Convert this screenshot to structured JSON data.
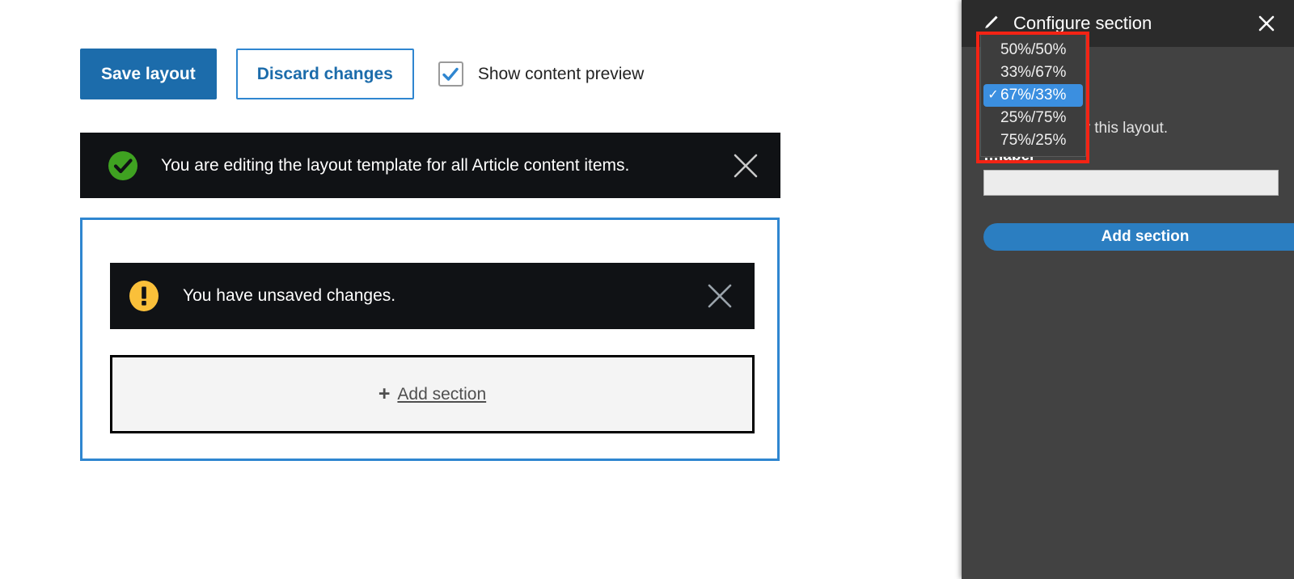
{
  "toolbar": {
    "save_label": "Save layout",
    "discard_label": "Discard changes",
    "preview_checkbox_label": "Show content preview",
    "preview_checked": true,
    "save_bg": "#1c6cab",
    "discard_border": "#2f86d0"
  },
  "status_message": {
    "icon": "success-check-circle-icon",
    "text": "You are editing the layout template for all Article content items.",
    "close_icon": "close-icon",
    "bg": "#101215",
    "icon_color": "#3fa221"
  },
  "layout_region": {
    "border_color": "#2f86d0",
    "unsaved_message": {
      "icon": "warning-exclamation-circle-icon",
      "text": "You have unsaved changes.",
      "close_icon": "close-icon",
      "bg": "#101215",
      "icon_color": "#fac03a"
    },
    "add_section": {
      "plus_glyph": "+",
      "label": "Add section"
    }
  },
  "config_panel": {
    "header": {
      "icon": "pencil-icon",
      "title": "Configure section",
      "close_icon": "close-icon",
      "bg": "#2b2b2b"
    },
    "bg": "#424242",
    "help_text": "…mn widths for this layout.",
    "field_label": "…label",
    "input_value": "",
    "input_placeholder": "",
    "add_section_label": "Add section",
    "add_section_bg": "#2b7ec1"
  },
  "width_dropdown": {
    "name": "column-widths-select",
    "selected": "67%/33%",
    "highlight_color": "#3b8fe0",
    "check_glyph": "✓",
    "options": [
      {
        "label": "50%/50%",
        "selected": false
      },
      {
        "label": "33%/67%",
        "selected": false
      },
      {
        "label": "67%/33%",
        "selected": true
      },
      {
        "label": "25%/75%",
        "selected": false
      },
      {
        "label": "75%/25%",
        "selected": false
      }
    ]
  },
  "annotation": {
    "highlight_color": "#f42314"
  }
}
